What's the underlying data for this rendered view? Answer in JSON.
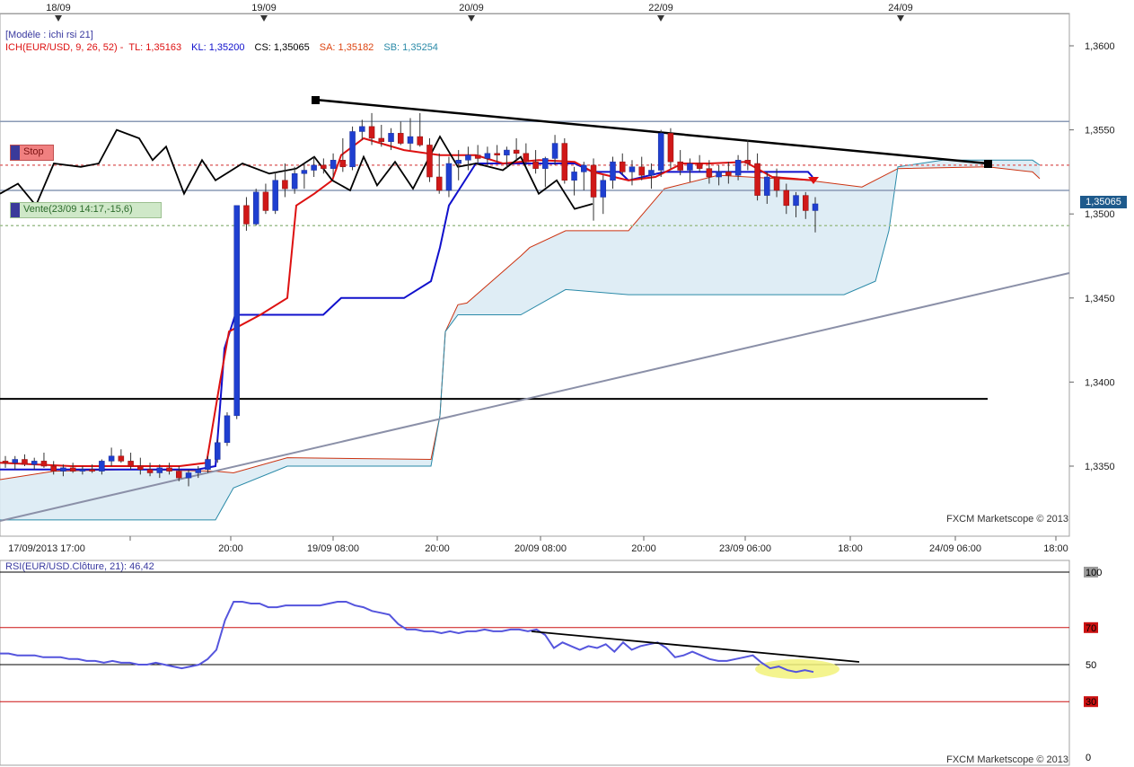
{
  "chart_data": [
    {
      "type": "candlestick",
      "title": "ICH(EUR/USD, 9, 26, 52)",
      "model_label": "[Modèle : ichi rsi 21]",
      "legend": {
        "ich": "ICH(EUR/USD, 9, 26, 52) - ",
        "tl": "TL: 1,35163",
        "kl": "KL: 1,35200",
        "cs": "CS: 1,35065",
        "sa": "SA: 1,35182",
        "sb": "SB: 1,35254"
      },
      "ylim": [
        1.3315,
        1.3615
      ],
      "y_ticks": [
        "1,3600",
        "1,3550",
        "1,3500",
        "1,3450",
        "1,3400",
        "1,3350"
      ],
      "y_tick_values": [
        1.36,
        1.355,
        1.35,
        1.345,
        1.34,
        1.335
      ],
      "current_price": "1,35065",
      "x_labels": [
        "17/09/2013 17:00",
        "20:00",
        "19/09 08:00",
        "20:00",
        "20/09 08:00",
        "20:00",
        "23/09 06:00",
        "18:00",
        "24/09 06:00",
        "18:00"
      ],
      "top_dates": [
        "18/09",
        "19/09",
        "20/09",
        "22/09",
        "24/09"
      ],
      "watermark": "FXCM Marketscope © 2013",
      "horizontal_levels": [
        {
          "name": "resistance",
          "value": 1.3555,
          "color": "#8a9ab5"
        },
        {
          "name": "support",
          "value": 1.3514,
          "color": "#8a9ab5"
        },
        {
          "name": "stop",
          "value": 1.3529,
          "color": "#e07070"
        },
        {
          "name": "entry",
          "value": 1.3493,
          "color": "#a0c090"
        },
        {
          "name": "black-level",
          "value": 1.339,
          "color": "#000000"
        }
      ],
      "stop_badge": "Stop",
      "vente_badge": "Vente(23/09 14:17,-15,6)",
      "candles": [
        [
          1.3353,
          1.3356,
          1.3349,
          1.3352
        ],
        [
          1.3352,
          1.3356,
          1.3348,
          1.3354
        ],
        [
          1.3354,
          1.3357,
          1.335,
          1.3351
        ],
        [
          1.3351,
          1.3355,
          1.3348,
          1.3353
        ],
        [
          1.3353,
          1.3358,
          1.3349,
          1.335
        ],
        [
          1.335,
          1.3353,
          1.3345,
          1.3347
        ],
        [
          1.3347,
          1.3351,
          1.3344,
          1.3349
        ],
        [
          1.3349,
          1.3352,
          1.3346,
          1.3347
        ],
        [
          1.3347,
          1.335,
          1.3345,
          1.3348
        ],
        [
          1.3348,
          1.3351,
          1.3346,
          1.3347
        ],
        [
          1.3347,
          1.3354,
          1.3345,
          1.3353
        ],
        [
          1.3353,
          1.3361,
          1.335,
          1.3356
        ],
        [
          1.3356,
          1.336,
          1.3352,
          1.3353
        ],
        [
          1.3353,
          1.3358,
          1.3348,
          1.335
        ],
        [
          1.335,
          1.3355,
          1.3345,
          1.3348
        ],
        [
          1.3348,
          1.3352,
          1.3344,
          1.3346
        ],
        [
          1.3346,
          1.3351,
          1.3343,
          1.3349
        ],
        [
          1.3349,
          1.3352,
          1.3345,
          1.3347
        ],
        [
          1.3347,
          1.335,
          1.3341,
          1.3343
        ],
        [
          1.3343,
          1.3348,
          1.3338,
          1.3346
        ],
        [
          1.3346,
          1.335,
          1.3343,
          1.3348
        ],
        [
          1.3348,
          1.3356,
          1.3346,
          1.3354
        ],
        [
          1.3354,
          1.3366,
          1.3352,
          1.3364
        ],
        [
          1.3364,
          1.3382,
          1.3362,
          1.338
        ],
        [
          1.338,
          1.347,
          1.3378,
          1.3505
        ],
        [
          1.3505,
          1.351,
          1.349,
          1.3494
        ],
        [
          1.3494,
          1.3515,
          1.3493,
          1.3513
        ],
        [
          1.3513,
          1.3518,
          1.35,
          1.3502
        ],
        [
          1.3502,
          1.3525,
          1.35,
          1.352
        ],
        [
          1.352,
          1.353,
          1.351,
          1.3515
        ],
        [
          1.3515,
          1.3528,
          1.3512,
          1.3524
        ],
        [
          1.3524,
          1.353,
          1.3515,
          1.3526
        ],
        [
          1.3526,
          1.3534,
          1.3522,
          1.3529
        ],
        [
          1.3529,
          1.3533,
          1.3524,
          1.3527
        ],
        [
          1.3527,
          1.3536,
          1.3522,
          1.3532
        ],
        [
          1.3532,
          1.3545,
          1.3525,
          1.3528
        ],
        [
          1.3528,
          1.3552,
          1.3526,
          1.3549
        ],
        [
          1.3549,
          1.3556,
          1.3544,
          1.3552
        ],
        [
          1.3552,
          1.356,
          1.3541,
          1.3545
        ],
        [
          1.3545,
          1.3553,
          1.354,
          1.3543
        ],
        [
          1.3543,
          1.3551,
          1.3538,
          1.3548
        ],
        [
          1.3548,
          1.3555,
          1.3541,
          1.3542
        ],
        [
          1.3542,
          1.3557,
          1.3538,
          1.3546
        ],
        [
          1.3546,
          1.356,
          1.354,
          1.3541
        ],
        [
          1.3541,
          1.3545,
          1.3519,
          1.3522
        ],
        [
          1.3522,
          1.3536,
          1.3512,
          1.3514
        ],
        [
          1.3514,
          1.3534,
          1.351,
          1.353
        ],
        [
          1.353,
          1.3538,
          1.352,
          1.3532
        ],
        [
          1.3532,
          1.354,
          1.3526,
          1.3535
        ],
        [
          1.3535,
          1.3541,
          1.3529,
          1.3533
        ],
        [
          1.3533,
          1.354,
          1.3528,
          1.3536
        ],
        [
          1.3536,
          1.3541,
          1.3531,
          1.3535
        ],
        [
          1.3535,
          1.354,
          1.3527,
          1.3538
        ],
        [
          1.3538,
          1.3545,
          1.3532,
          1.3536
        ],
        [
          1.3536,
          1.3542,
          1.3529,
          1.3531
        ],
        [
          1.3531,
          1.3538,
          1.3524,
          1.3527
        ],
        [
          1.3527,
          1.3534,
          1.3516,
          1.3533
        ],
        [
          1.3533,
          1.3547,
          1.3529,
          1.3542
        ],
        [
          1.3542,
          1.3545,
          1.3518,
          1.352
        ],
        [
          1.352,
          1.3528,
          1.3511,
          1.3525
        ],
        [
          1.3525,
          1.3531,
          1.3514,
          1.3529
        ],
        [
          1.3529,
          1.3533,
          1.3496,
          1.351
        ],
        [
          1.351,
          1.3523,
          1.35,
          1.352
        ],
        [
          1.352,
          1.3534,
          1.3515,
          1.3531
        ],
        [
          1.3531,
          1.3536,
          1.3523,
          1.3525
        ],
        [
          1.3525,
          1.3532,
          1.3517,
          1.3528
        ],
        [
          1.3528,
          1.3534,
          1.352,
          1.3523
        ],
        [
          1.3523,
          1.353,
          1.3515,
          1.3526
        ],
        [
          1.3526,
          1.355,
          1.3522,
          1.3548
        ],
        [
          1.3548,
          1.3551,
          1.3527,
          1.3531
        ],
        [
          1.3531,
          1.3538,
          1.3523,
          1.3526
        ],
        [
          1.3526,
          1.3533,
          1.3519,
          1.353
        ],
        [
          1.353,
          1.3535,
          1.3525,
          1.3527
        ],
        [
          1.3527,
          1.3532,
          1.3518,
          1.3522
        ],
        [
          1.3522,
          1.3529,
          1.3517,
          1.3525
        ],
        [
          1.3525,
          1.3531,
          1.3518,
          1.3523
        ],
        [
          1.3523,
          1.3535,
          1.352,
          1.3532
        ],
        [
          1.3532,
          1.3544,
          1.3526,
          1.353
        ],
        [
          1.353,
          1.3536,
          1.3508,
          1.3511
        ],
        [
          1.3511,
          1.3525,
          1.3506,
          1.3522
        ],
        [
          1.3522,
          1.3527,
          1.351,
          1.3514
        ],
        [
          1.3514,
          1.3518,
          1.35,
          1.3505
        ],
        [
          1.3505,
          1.3513,
          1.3498,
          1.3511
        ],
        [
          1.3511,
          1.3513,
          1.3497,
          1.3502
        ],
        [
          1.3502,
          1.351,
          1.3489,
          1.3506
        ]
      ]
    },
    {
      "type": "line",
      "title": "RSI(EUR/USD.Clôture, 21)",
      "value_label": "46,42",
      "ylim": [
        0,
        100
      ],
      "y_ticks": [
        "100",
        "70",
        "50",
        "30",
        "0"
      ],
      "levels": [
        70,
        50,
        30
      ],
      "watermark": "FXCM Marketscope © 2013",
      "values": [
        56,
        56,
        55,
        55,
        55,
        54,
        54,
        54,
        53,
        53,
        52,
        52,
        51,
        52,
        51,
        51,
        50,
        50,
        51,
        50,
        49,
        48,
        49,
        50,
        53,
        58,
        74,
        84,
        84,
        83,
        83,
        81,
        81,
        82,
        82,
        82,
        82,
        82,
        83,
        84,
        84,
        82,
        81,
        79,
        78,
        77,
        72,
        69,
        69,
        68,
        68,
        67,
        68,
        67,
        68,
        68,
        69,
        68,
        68,
        69,
        69,
        68,
        69,
        66,
        59,
        62,
        60,
        58,
        60,
        59,
        61,
        57,
        62,
        58,
        60,
        61,
        62,
        59,
        54,
        55,
        57,
        55,
        53,
        52,
        52,
        53,
        54,
        55,
        51,
        48,
        49,
        47,
        46,
        47,
        46
      ]
    }
  ]
}
